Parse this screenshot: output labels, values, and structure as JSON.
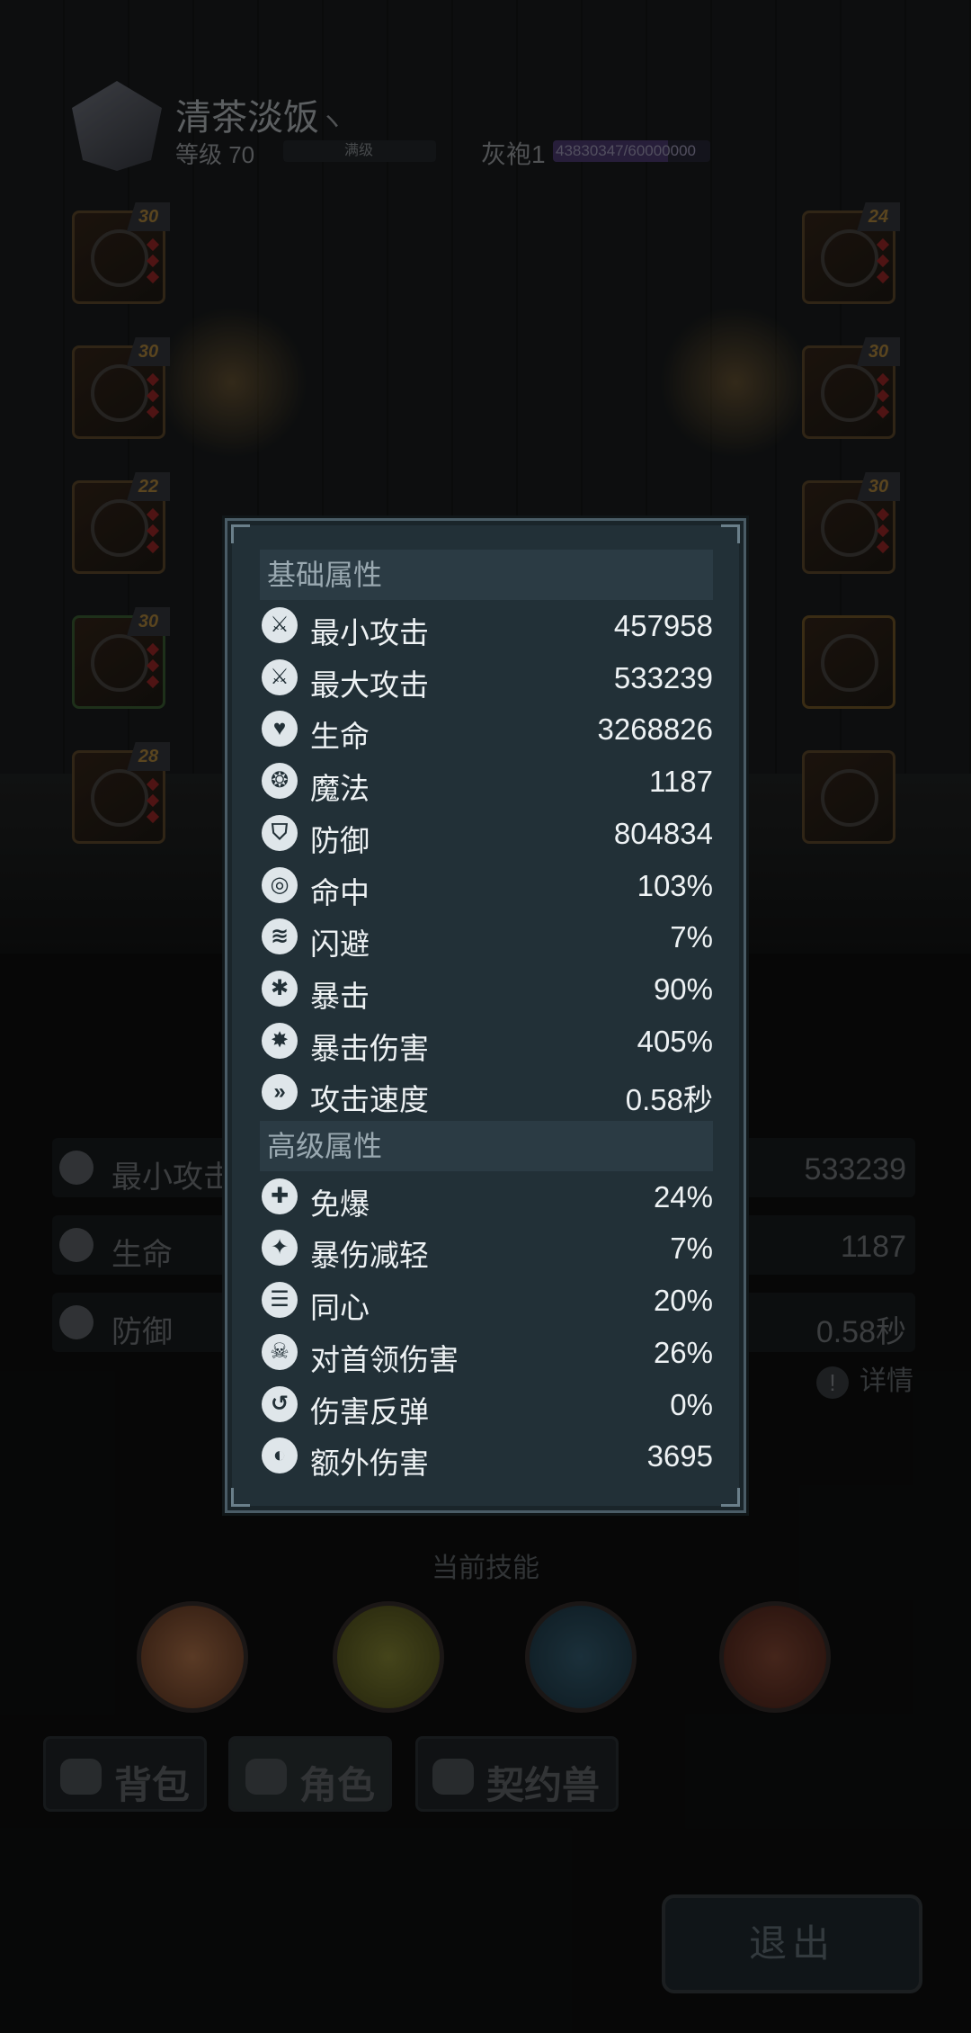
{
  "player": {
    "name": "清茶淡饭",
    "name_suffix": "ヽ",
    "level_text": "等级 70",
    "level_bar_text": "满级",
    "title_text": "灰袍1",
    "exp_text": "43830347/60000000",
    "exp_fraction": 0.73
  },
  "equipment": {
    "left_levels": [
      "30",
      "30",
      "22",
      "30",
      "28"
    ],
    "right_levels": [
      "24",
      "30",
      "30",
      "",
      ""
    ]
  },
  "panel": {
    "basic_title": "基础属性",
    "basic": [
      {
        "label": "最小攻击",
        "value": "457958",
        "icon": "sword-icon"
      },
      {
        "label": "最大攻击",
        "value": "533239",
        "icon": "sword-icon"
      },
      {
        "label": "生命",
        "value": "3268826",
        "icon": "heart-icon"
      },
      {
        "label": "魔法",
        "value": "1187",
        "icon": "magic-swirl-icon"
      },
      {
        "label": "防御",
        "value": "804834",
        "icon": "shield-icon"
      },
      {
        "label": "命中",
        "value": "103%",
        "icon": "target-icon"
      },
      {
        "label": "闪避",
        "value": "7%",
        "icon": "dodge-wind-icon"
      },
      {
        "label": "暴击",
        "value": "90%",
        "icon": "crit-claw-icon"
      },
      {
        "label": "暴击伤害",
        "value": "405%",
        "icon": "crit-burst-icon"
      },
      {
        "label": "攻击速度",
        "value": "0.58秒",
        "icon": "attack-speed-icon"
      }
    ],
    "advanced_title": "高级属性",
    "advanced": [
      {
        "label": "免爆",
        "value": "24%",
        "icon": "crit-immune-icon"
      },
      {
        "label": "暴伤减轻",
        "value": "7%",
        "icon": "crit-reduce-icon"
      },
      {
        "label": "同心",
        "value": "20%",
        "icon": "scroll-icon"
      },
      {
        "label": "对首领伤害",
        "value": "26%",
        "icon": "boss-skull-icon"
      },
      {
        "label": "伤害反弹",
        "value": "0%",
        "icon": "reflect-icon"
      },
      {
        "label": "额外伤害",
        "value": "3695",
        "icon": "extra-damage-icon"
      }
    ]
  },
  "preview": {
    "rows": [
      {
        "label": "最小攻击",
        "value": "533239"
      },
      {
        "label": "生命",
        "value": "1187"
      },
      {
        "label": "防御",
        "value": "0.58秒"
      }
    ],
    "details": "详情",
    "details_mark": "!"
  },
  "skills_title": "当前技能",
  "tabs": {
    "bag": "背包",
    "character": "角色",
    "pet": "契约兽"
  },
  "exit": "退出",
  "colors": {
    "panel_bg": "#223037",
    "section_bg": "#2b3b44",
    "text": "#eef2f4",
    "exp_fill": "#3c2f5a"
  }
}
